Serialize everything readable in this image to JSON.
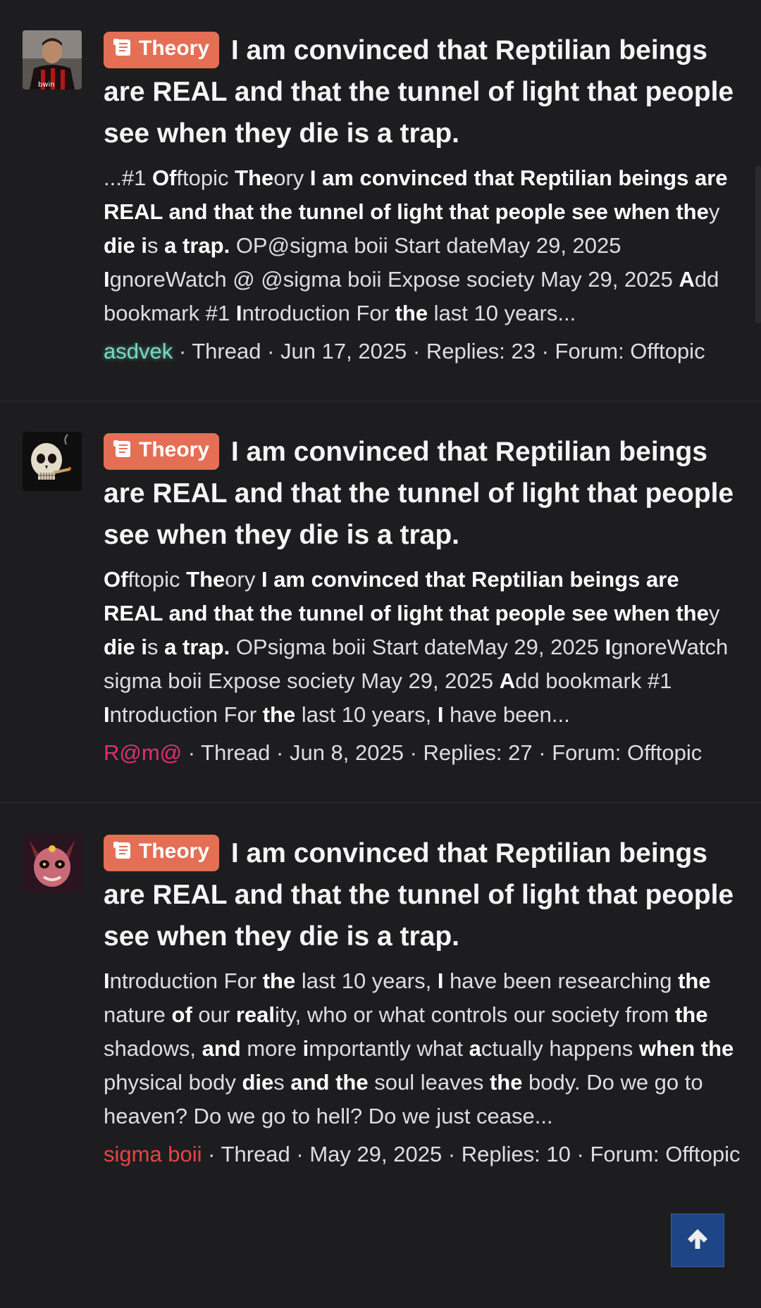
{
  "results": [
    {
      "prefix": "Theory",
      "title": "I am convinced that Reptilian beings are REAL and that the tunnel of light that people see when they die is a trap.",
      "snippet": [
        {
          "t": "...#1 ",
          "b": false
        },
        {
          "t": "Of",
          "b": true
        },
        {
          "t": "ftopic ",
          "b": false
        },
        {
          "t": "The",
          "b": true
        },
        {
          "t": "ory ",
          "b": false
        },
        {
          "t": "I am convinced that Reptilian beings are REAL and that the tunnel of light that people see when the",
          "b": true
        },
        {
          "t": "y ",
          "b": false
        },
        {
          "t": "die",
          "b": true
        },
        {
          "t": " ",
          "b": false
        },
        {
          "t": "i",
          "b": true
        },
        {
          "t": "s ",
          "b": false
        },
        {
          "t": "a trap.",
          "b": true
        },
        {
          "t": " OP@sigma boii Start dateMay 29, 2025 ",
          "b": false
        },
        {
          "t": "I",
          "b": true
        },
        {
          "t": "gnoreWatch @ @sigma boii Expose society May 29, 2025 ",
          "b": false
        },
        {
          "t": "A",
          "b": true
        },
        {
          "t": "dd bookmark #1 ",
          "b": false
        },
        {
          "t": "I",
          "b": true
        },
        {
          "t": "ntroduction For ",
          "b": false
        },
        {
          "t": "the",
          "b": true
        },
        {
          "t": " last 10 years...",
          "b": false
        }
      ],
      "author": "asdvek",
      "type": "Thread",
      "date": "Jun 17, 2025",
      "replies": "Replies: 23",
      "forum": "Forum: Offtopic"
    },
    {
      "prefix": "Theory",
      "title": "I am convinced that Reptilian beings are REAL and that the tunnel of light that people see when they die is a trap.",
      "snippet": [
        {
          "t": "Of",
          "b": true
        },
        {
          "t": "ftopic ",
          "b": false
        },
        {
          "t": "The",
          "b": true
        },
        {
          "t": "ory ",
          "b": false
        },
        {
          "t": "I am convinced that Reptilian beings are REAL and that the tunnel of light that people see when the",
          "b": true
        },
        {
          "t": "y ",
          "b": false
        },
        {
          "t": "die",
          "b": true
        },
        {
          "t": " ",
          "b": false
        },
        {
          "t": "i",
          "b": true
        },
        {
          "t": "s ",
          "b": false
        },
        {
          "t": "a trap.",
          "b": true
        },
        {
          "t": " OPsigma boii Start dateMay 29, 2025 ",
          "b": false
        },
        {
          "t": "I",
          "b": true
        },
        {
          "t": "gnoreWatch sigma boii Expose society May 29, 2025 ",
          "b": false
        },
        {
          "t": "A",
          "b": true
        },
        {
          "t": "dd bookmark #1 ",
          "b": false
        },
        {
          "t": "I",
          "b": true
        },
        {
          "t": "ntroduction For ",
          "b": false
        },
        {
          "t": "the",
          "b": true
        },
        {
          "t": " last 10 years, ",
          "b": false
        },
        {
          "t": "I",
          "b": true
        },
        {
          "t": " have been...",
          "b": false
        }
      ],
      "author": "R@m@",
      "type": "Thread",
      "date": "Jun 8, 2025",
      "replies": "Replies: 27",
      "forum": "Forum: Offtopic"
    },
    {
      "prefix": "Theory",
      "title": "I am convinced that Reptilian beings are REAL and that the tunnel of light that people see when they die is a trap.",
      "snippet": [
        {
          "t": "I",
          "b": true
        },
        {
          "t": "ntroduction For ",
          "b": false
        },
        {
          "t": "the",
          "b": true
        },
        {
          "t": " last 10 years, ",
          "b": false
        },
        {
          "t": "I",
          "b": true
        },
        {
          "t": " have been researching ",
          "b": false
        },
        {
          "t": "the",
          "b": true
        },
        {
          "t": " nature ",
          "b": false
        },
        {
          "t": "of",
          "b": true
        },
        {
          "t": " our ",
          "b": false
        },
        {
          "t": "real",
          "b": true
        },
        {
          "t": "ity, who or what controls our society from ",
          "b": false
        },
        {
          "t": "the",
          "b": true
        },
        {
          "t": " shadows, ",
          "b": false
        },
        {
          "t": "and",
          "b": true
        },
        {
          "t": " more ",
          "b": false
        },
        {
          "t": "i",
          "b": true
        },
        {
          "t": "mportantly what ",
          "b": false
        },
        {
          "t": "a",
          "b": true
        },
        {
          "t": "ctually happens ",
          "b": false
        },
        {
          "t": "when the",
          "b": true
        },
        {
          "t": " physical body ",
          "b": false
        },
        {
          "t": "die",
          "b": true
        },
        {
          "t": "s ",
          "b": false
        },
        {
          "t": "and the",
          "b": true
        },
        {
          "t": " soul leaves ",
          "b": false
        },
        {
          "t": "the",
          "b": true
        },
        {
          "t": " body. Do we go to heaven? Do we go to hell? Do we just cease...",
          "b": false
        }
      ],
      "author": "sigma boii",
      "type": "Thread",
      "date": "May 29, 2025",
      "replies": "Replies: 10",
      "forum": "Forum: Offtopic"
    }
  ],
  "separator": " · ",
  "colors": {
    "background": "#1d1d1f",
    "prefix_theory": "#e46f55",
    "user_asdvek": "#78d9c2",
    "user_ram": "#e0306c",
    "user_sigma": "#e44545",
    "scroll_top_button": "#1f4a8f"
  },
  "icons": {
    "prefix": "scroll-icon",
    "scroll_top": "arrow-up-icon"
  }
}
